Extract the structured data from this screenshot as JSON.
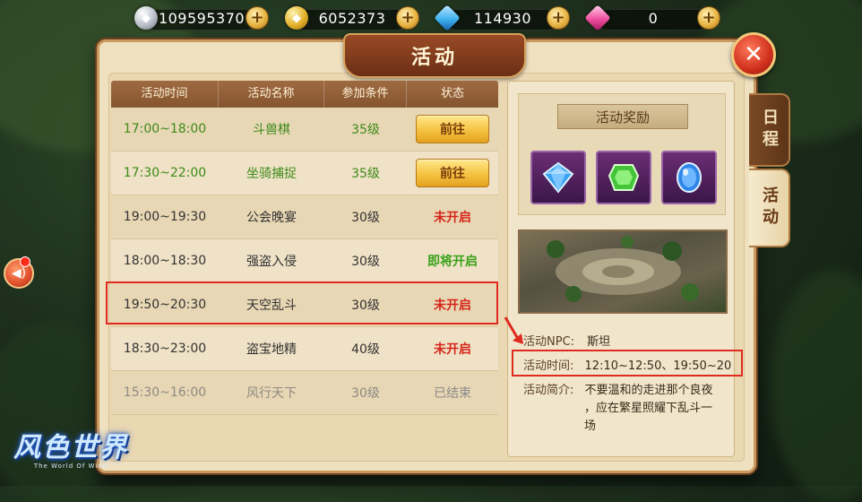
{
  "currencies": [
    {
      "icon": "silver-coin-icon",
      "value": "109595370",
      "color": "#c9cdd6"
    },
    {
      "icon": "gold-coin-icon",
      "value": "6052373",
      "color": "#e3b02a"
    },
    {
      "icon": "blue-diamond-icon",
      "value": "114930",
      "color": "#3fb2ef"
    },
    {
      "icon": "pink-diamond-icon",
      "value": "0",
      "color": "#ef4fa0"
    }
  ],
  "panel": {
    "title": "活动",
    "close_label": "✕"
  },
  "tabs": [
    {
      "label": "日程",
      "active": false
    },
    {
      "label": "活动",
      "active": true
    }
  ],
  "table": {
    "headers": [
      "活动时间",
      "活动名称",
      "参加条件",
      "状态"
    ],
    "rows": [
      {
        "time": "17:00~18:00",
        "name": "斗兽棋",
        "level": "35级",
        "status": "前往",
        "style": "green",
        "status_type": "button"
      },
      {
        "time": "17:30~22:00",
        "name": "坐骑捕捉",
        "level": "35级",
        "status": "前往",
        "style": "green",
        "status_type": "button"
      },
      {
        "time": "19:00~19:30",
        "name": "公会晚宴",
        "level": "30级",
        "status": "未开启",
        "style": "red",
        "status_type": "red"
      },
      {
        "time": "18:00~18:30",
        "name": "强盗入侵",
        "level": "30级",
        "status": "即将开启",
        "style": "red",
        "status_type": "green"
      },
      {
        "time": "19:50~20:30",
        "name": "天空乱斗",
        "level": "30级",
        "status": "未开启",
        "style": "red",
        "status_type": "red"
      },
      {
        "time": "18:30~23:00",
        "name": "盗宝地精",
        "level": "40级",
        "status": "未开启",
        "style": "red",
        "status_type": "red"
      },
      {
        "time": "15:30~16:00",
        "name": "风行天下",
        "level": "30级",
        "status": "已结束",
        "style": "gray",
        "status_type": "gray"
      }
    ]
  },
  "detail": {
    "rewards_title": "活动奖励",
    "rewards": [
      {
        "icon": "blue-gem-icon",
        "color": "#3aa2f0"
      },
      {
        "icon": "green-gem-icon",
        "color": "#45c43a"
      },
      {
        "icon": "blue-orb-icon",
        "color": "#2f86e8"
      }
    ],
    "npc_label": "活动NPC:",
    "npc_value": "斯坦",
    "time_label": "活动时间:",
    "time_value": "12:10~12:50、19:50~20",
    "intro_label": "活动简介:",
    "intro_line1": "不要温和的走进那个良夜",
    "intro_line2": "，应在繁星照耀下乱斗一",
    "intro_line3": "场"
  },
  "logo": {
    "main": "风色世界",
    "sub": "The World Of Wind"
  }
}
